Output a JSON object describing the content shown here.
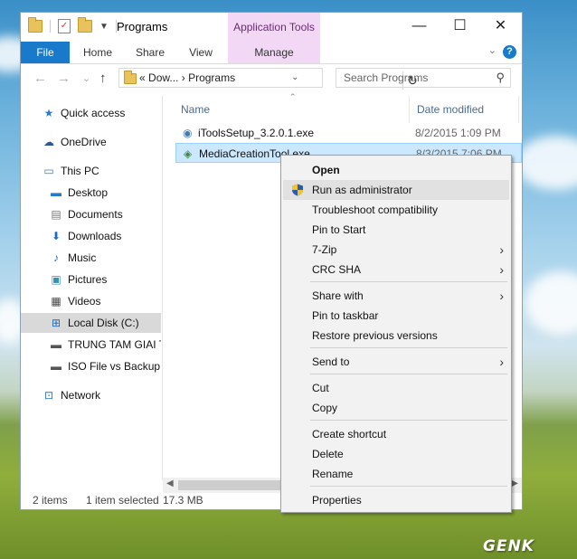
{
  "window": {
    "title": "Programs",
    "contextual_tab_group": "Application Tools",
    "controls": {
      "minimize": "—",
      "maximize": "☐",
      "close": "✕"
    }
  },
  "ribbon": {
    "tabs": [
      {
        "label": "File"
      },
      {
        "label": "Home"
      },
      {
        "label": "Share"
      },
      {
        "label": "View"
      },
      {
        "label": "Manage"
      }
    ],
    "help": "?"
  },
  "nav": {
    "back": "←",
    "forward": "→",
    "recent": "⌄",
    "up": "↑",
    "address_prefix": "«",
    "breadcrumb_parent": "Dow...",
    "breadcrumb_sep": "›",
    "breadcrumb_current": "Programs",
    "refresh": "↻",
    "search_placeholder": "Search Programs"
  },
  "sidebar": {
    "items": [
      {
        "label": "Quick access",
        "icon": "★"
      },
      {
        "label": "OneDrive",
        "icon": "☁"
      },
      {
        "label": "This PC",
        "icon": "▭"
      },
      {
        "label": "Desktop",
        "icon": "▬"
      },
      {
        "label": "Documents",
        "icon": "▤"
      },
      {
        "label": "Downloads",
        "icon": "⬇"
      },
      {
        "label": "Music",
        "icon": "♪"
      },
      {
        "label": "Pictures",
        "icon": "▣"
      },
      {
        "label": "Videos",
        "icon": "▦"
      },
      {
        "label": "Local Disk (C:)",
        "icon": "⊞"
      },
      {
        "label": "TRUNG TAM GIAI T",
        "icon": "▬"
      },
      {
        "label": "ISO File vs Backup (",
        "icon": "▬"
      },
      {
        "label": "Network",
        "icon": "⊡"
      }
    ]
  },
  "files": {
    "columns": {
      "name": "Name",
      "date": "Date modified"
    },
    "rows": [
      {
        "name": "iToolsSetup_3.2.0.1.exe",
        "date": "8/2/2015 1:09 PM",
        "icon": "◉"
      },
      {
        "name": "MediaCreationTool.exe",
        "date": "8/3/2015 7:06 PM",
        "icon": "◈"
      }
    ]
  },
  "status": {
    "items_count": "2 items",
    "selected": "1 item selected",
    "size": "17.3 MB"
  },
  "context_menu": {
    "items": [
      {
        "label": "Open"
      },
      {
        "label": "Run as administrator"
      },
      {
        "label": "Troubleshoot compatibility"
      },
      {
        "label": "Pin to Start"
      },
      {
        "label": "7-Zip"
      },
      {
        "label": "CRC SHA"
      },
      {
        "label": "Share with"
      },
      {
        "label": "Pin to taskbar"
      },
      {
        "label": "Restore previous versions"
      },
      {
        "label": "Send to"
      },
      {
        "label": "Cut"
      },
      {
        "label": "Copy"
      },
      {
        "label": "Create shortcut"
      },
      {
        "label": "Delete"
      },
      {
        "label": "Rename"
      },
      {
        "label": "Properties"
      }
    ],
    "submenu_arrow": "›"
  },
  "watermark": "GENK",
  "colors": {
    "accent": "#1979ca",
    "contextual_tab": "#f3d8f5",
    "selection": "#cce8ff",
    "menu_bg": "#f2f2f2"
  }
}
